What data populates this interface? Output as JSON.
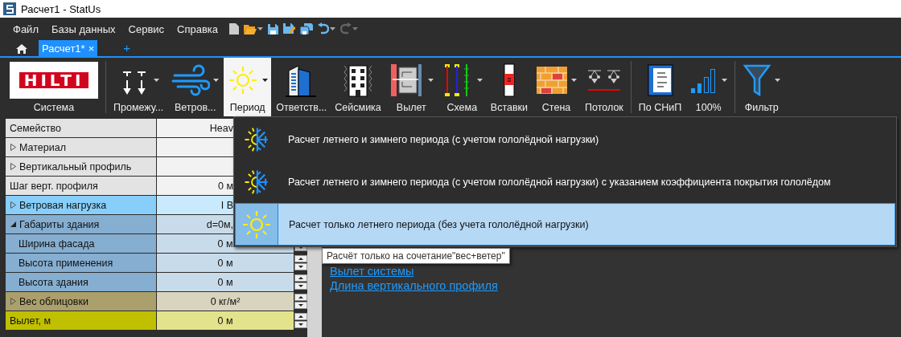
{
  "window": {
    "title": "Расчет1 - StatUs"
  },
  "menu": [
    "Файл",
    "Базы данных",
    "Сервис",
    "Справка"
  ],
  "quick_access": [
    {
      "kind": "new"
    },
    {
      "kind": "open",
      "dropdown": true
    },
    {
      "kind": "save"
    },
    {
      "kind": "save-as"
    },
    {
      "kind": "save-all"
    },
    {
      "kind": "undo",
      "dropdown": true
    },
    {
      "kind": "redo",
      "disabled": true,
      "dropdown": true
    }
  ],
  "tabs": [
    {
      "label": "Расчет1*",
      "close": "×",
      "selected": true
    }
  ],
  "add_tab": "+",
  "toolbar": [
    {
      "kind": "logo",
      "label": "Система",
      "logo": "HILTI",
      "selected": false
    },
    {
      "kind": "separator"
    },
    {
      "kind": "supports",
      "label": "Промежу...",
      "dropdown": true,
      "selected": false
    },
    {
      "kind": "wind",
      "label": "Ветров...",
      "dropdown": true,
      "selected": false
    },
    {
      "kind": "sun",
      "label": "Период",
      "dropdown": true,
      "selected": true
    },
    {
      "kind": "towers",
      "label": "Ответств...",
      "selected": false
    },
    {
      "kind": "seismic",
      "label": "Сейсмика",
      "selected": false
    },
    {
      "kind": "offset",
      "label": "Вылет",
      "dropdown": true,
      "selected": false
    },
    {
      "kind": "scheme",
      "label": "Схема",
      "dropdown": true,
      "selected": false
    },
    {
      "kind": "insert",
      "label": "Вставки",
      "selected": false
    },
    {
      "kind": "brick",
      "label": "Стена",
      "dropdown": true,
      "selected": false
    },
    {
      "kind": "ceiling",
      "label": "Потолок",
      "selected": false
    },
    {
      "kind": "separator"
    },
    {
      "kind": "book",
      "label": "По СНиП",
      "selected": false
    },
    {
      "kind": "signal",
      "label": "100%",
      "dropdown": true,
      "selected": false
    },
    {
      "kind": "separator"
    },
    {
      "kind": "filter",
      "label": "Фильтр",
      "dropdown": true,
      "selected": false
    }
  ],
  "properties": [
    {
      "label": "Семейство",
      "value": "Heav",
      "cut": true,
      "color": "#e3e3e3"
    },
    {
      "label": "Материал",
      "expanded": false,
      "color": "#e3e3e3"
    },
    {
      "label": "Вертикальный профиль",
      "expanded": false,
      "color": "#e3e3e3"
    },
    {
      "label": "Шаг верт. профиля",
      "value": "0 м",
      "cut": true,
      "color": "#e3e3e3"
    },
    {
      "label": "Ветровая нагрузка",
      "expanded": false,
      "value": "I В",
      "cut": true,
      "color": "#87cefa"
    },
    {
      "label": "Габариты здания",
      "expanded": true,
      "value": "d=0м,",
      "cut": true,
      "color": "#85aed0",
      "children": [
        {
          "label": "Ширина фасада",
          "value": "0 м",
          "spinner": true,
          "color": "#85aed0"
        },
        {
          "label": "Высота применения",
          "value": "0 м",
          "spinner": true,
          "color": "#85aed0"
        },
        {
          "label": "Высота здания",
          "value": "0 м",
          "spinner": true,
          "color": "#85aed0"
        }
      ]
    },
    {
      "label": "Вес облицовки",
      "expanded": false,
      "value": "0 кг/м²",
      "spinner": true,
      "color": "#ab9f6c"
    },
    {
      "label": "Вылет, м",
      "value": "0 м",
      "spinner": true,
      "color": "#c0c000"
    }
  ],
  "links": [
    "Вылет системы",
    "Длина вертикального профиля"
  ],
  "dropdown": [
    {
      "kind": "sun-snow",
      "label": "Расчет летнего и зимнего периода (с учетом гололёдной нагрузки)",
      "selected": false
    },
    {
      "kind": "sun-snow",
      "label": "Расчет летнего и зимнего периода (с учетом гололёдной нагрузки) с указанием коэффициента покрытия гололёдом",
      "selected": false
    },
    {
      "kind": "sun",
      "label": "Расчет только летнего периода (без учета гололёдной нагрузки)",
      "selected": true
    }
  ],
  "tooltip": "Расчёт только на сочетание\"вес+ветер\""
}
